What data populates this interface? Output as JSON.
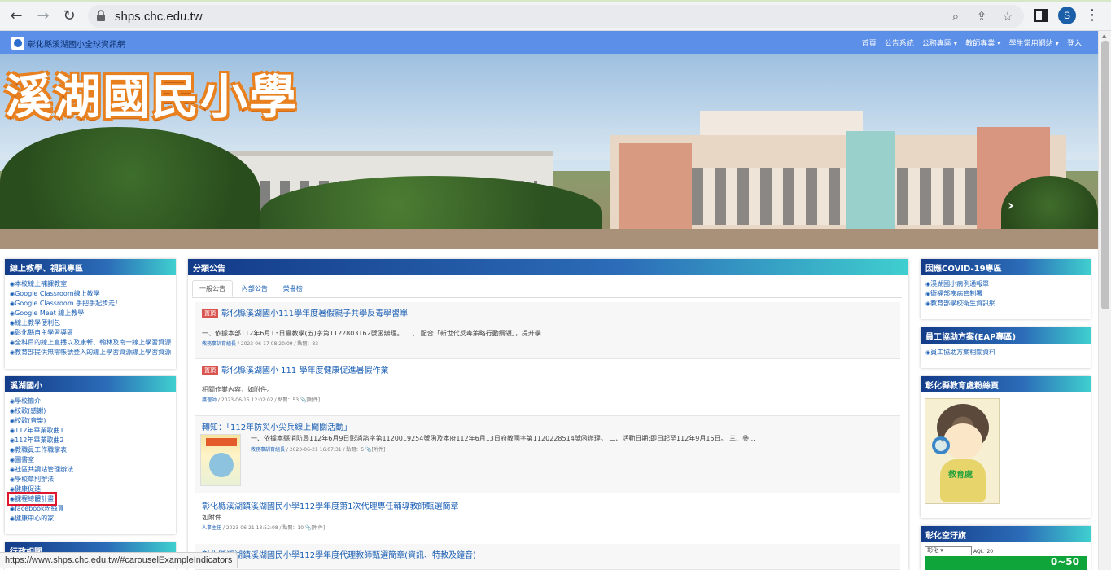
{
  "browser": {
    "url": "shps.chc.edu.tw",
    "avatar_letter": "S",
    "status_url": "https://www.shps.chc.edu.tw/#carouselExampleIndicators"
  },
  "site": {
    "brand": "彰化縣溪湖國小全球資訊網",
    "menu": [
      "首頁",
      "公告系統",
      "公務專區 ▾",
      "教師專業 ▾",
      "學生常用網站 ▾",
      "登入"
    ]
  },
  "banner": {
    "title": "溪湖國民小學"
  },
  "left": {
    "panel1": {
      "title": "線上教學、視訊專區",
      "items": [
        "本校線上補課教室",
        "Google Classroom線上教學",
        "Google Classroom 手把手起步走！",
        "Google Meet 線上教學",
        "線上教學便利包",
        "彰化縣自主學習導區",
        "全科目的線上直播以及康軒、翰林及南一線上學習資源",
        "教育部提供無需帳號登入的線上學習資源線上學習資源"
      ]
    },
    "panel2": {
      "title": "溪湖國小",
      "items": [
        "學校簡介",
        "校歌(感謝)",
        "校歌(音樂)",
        "112年畢業歌曲1",
        "112年畢業歌曲2",
        "教職員工作職掌表",
        "圖書室",
        "社區共讀站管理辦法",
        "學校章則辦法",
        "健康促進",
        "課程總體計畫",
        "facebook粉絲頁",
        "健康中心的家"
      ]
    },
    "panel3": {
      "title": "行政相關"
    }
  },
  "center": {
    "title": "分類公告",
    "tabs": [
      "一般公告",
      "內部公告",
      "榮譽榜"
    ],
    "announcements": [
      {
        "hot": "置頂",
        "title": "彰化縣溪湖國小111學年度暑假親子共學反毒學習單",
        "body": "一、依據本部112年6月13日臺教學(五)字第1122803162號函辦理。 二、 配合「新世代反毒策略行動綱領」，提升學...",
        "by": "教務事訓育組長",
        "meta": " / 2023-06-17 08:20:09 / 點閱：83"
      },
      {
        "hot": "置頂",
        "title": "彰化縣溪湖國小 111 學年度健康促進暑假作業",
        "body": "相關作業內容，如附件。",
        "by": "護理師",
        "meta": " / 2023-06-15 12:02:02 / 點閱：53 📎[附件]"
      },
      {
        "title": "轉知：「112年防災小尖兵線上闖關活動」",
        "body": "一、依據本縣消防局112年6月9日彰消諮字第1120019254號函及本府112年6月13日府教國字第1120228514號函辦理。 二、活動日期:即日起至112年9月15日。 三、參...",
        "by": "教務事訓育組長",
        "meta": " / 2023-06-21 16:07:31 / 點閱：5 📎[附件]"
      },
      {
        "title": "彰化縣溪湖鎮溪湖國民小學112學年度第1次代理專任輔導教師甄選簡章",
        "body": "如附件",
        "by": "人事主任",
        "meta": " / 2023-06-21 13:52:08 / 點閱：10 📎[附件]"
      },
      {
        "title": "彰化縣溪湖鎮溪湖國民小學112學年度代理教師甄選簡章(資訊、特教及鐘音)"
      }
    ]
  },
  "right": {
    "panel1": {
      "title": "因應COVID-19專區",
      "items": [
        "溪湖國小病例通報單",
        "衛福部疾病管制署",
        "教育部學校衛生資訊網"
      ]
    },
    "panel2": {
      "title": "員工協助方案(EAP專區)",
      "items": [
        "員工協助方案相關資料"
      ]
    },
    "panel3": {
      "title": "彰化縣教育處粉絲頁",
      "mascot_label": "教育處"
    },
    "panel4": {
      "title": "彰化空汙旗",
      "select": "彰化",
      "aqi_label": "AQI：20",
      "aqi_value": "0~50"
    }
  }
}
